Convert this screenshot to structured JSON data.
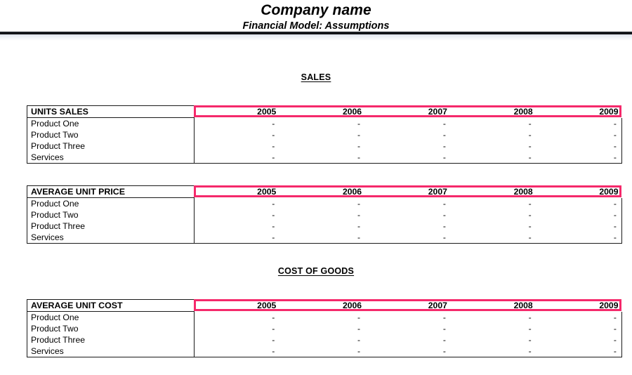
{
  "header": {
    "title": "Company name",
    "subtitle": "Financial Model: Assumptions"
  },
  "sections": [
    {
      "id": "sales",
      "heading": "SALES"
    },
    {
      "id": "cost-of-goods",
      "heading": "COST OF GOODS"
    }
  ],
  "years": [
    "2005",
    "2006",
    "2007",
    "2008",
    "2009"
  ],
  "empty_value": "-",
  "colors": {
    "highlight": "#f5296b",
    "border": "#1a1a1a",
    "rule": "#111418"
  },
  "tables": [
    {
      "id": "units-sales",
      "title": "UNITS SALES",
      "years": [
        "2005",
        "2006",
        "2007",
        "2008",
        "2009"
      ],
      "rows": [
        {
          "label": "Product One",
          "values": [
            "-",
            "-",
            "-",
            "-",
            "-"
          ]
        },
        {
          "label": "Product Two",
          "values": [
            "-",
            "-",
            "-",
            "-",
            "-"
          ]
        },
        {
          "label": "Product Three",
          "values": [
            "-",
            "-",
            "-",
            "-",
            "-"
          ]
        },
        {
          "label": "Services",
          "values": [
            "-",
            "-",
            "-",
            "-",
            "-"
          ]
        }
      ]
    },
    {
      "id": "average-unit-price",
      "title": "AVERAGE UNIT PRICE",
      "years": [
        "2005",
        "2006",
        "2007",
        "2008",
        "2009"
      ],
      "rows": [
        {
          "label": "Product One",
          "values": [
            "-",
            "-",
            "-",
            "-",
            "-"
          ]
        },
        {
          "label": "Product Two",
          "values": [
            "-",
            "-",
            "-",
            "-",
            "-"
          ]
        },
        {
          "label": "Product Three",
          "values": [
            "-",
            "-",
            "-",
            "-",
            "-"
          ]
        },
        {
          "label": "Services",
          "values": [
            "-",
            "-",
            "-",
            "-",
            "-"
          ]
        }
      ]
    },
    {
      "id": "average-unit-cost",
      "title": "AVERAGE UNIT COST",
      "years": [
        "2005",
        "2006",
        "2007",
        "2008",
        "2009"
      ],
      "rows": [
        {
          "label": "Product One",
          "values": [
            "-",
            "-",
            "-",
            "-",
            "-"
          ]
        },
        {
          "label": "Product Two",
          "values": [
            "-",
            "-",
            "-",
            "-",
            "-"
          ]
        },
        {
          "label": "Product Three",
          "values": [
            "-",
            "-",
            "-",
            "-",
            "-"
          ]
        },
        {
          "label": "Services",
          "values": [
            "-",
            "-",
            "-",
            "-",
            "-"
          ]
        }
      ]
    }
  ]
}
